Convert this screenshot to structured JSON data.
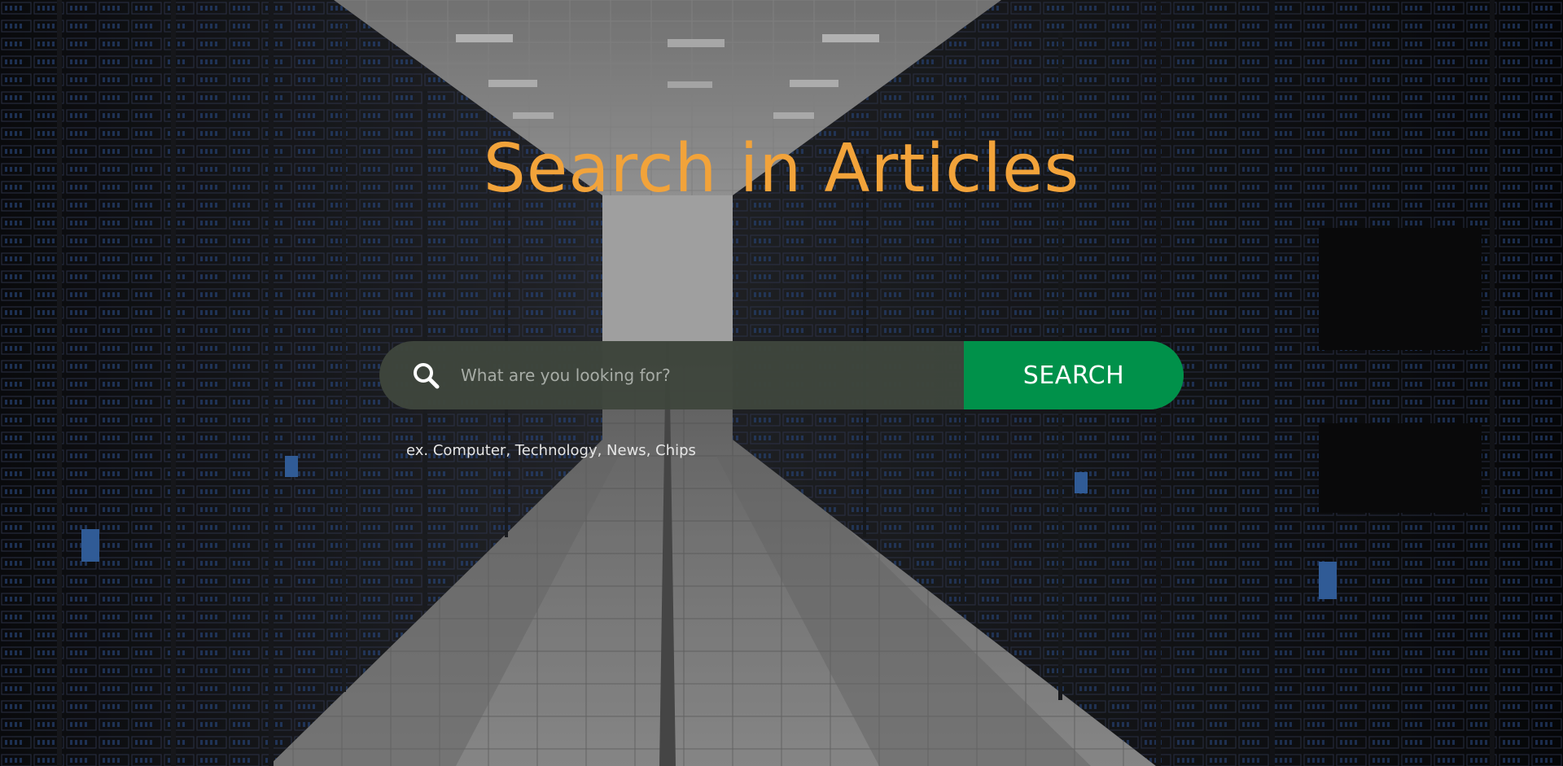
{
  "page": {
    "title": "Search in Articles",
    "title_color": "#f2a33a"
  },
  "search": {
    "icon": "search-icon",
    "placeholder": "What are you looking for?",
    "value": "",
    "button_label": "SEARCH",
    "button_color": "#00914a",
    "bar_color": "#3e463c"
  },
  "hint": {
    "examples_text": "ex. Computer, Technology, News, Chips"
  }
}
